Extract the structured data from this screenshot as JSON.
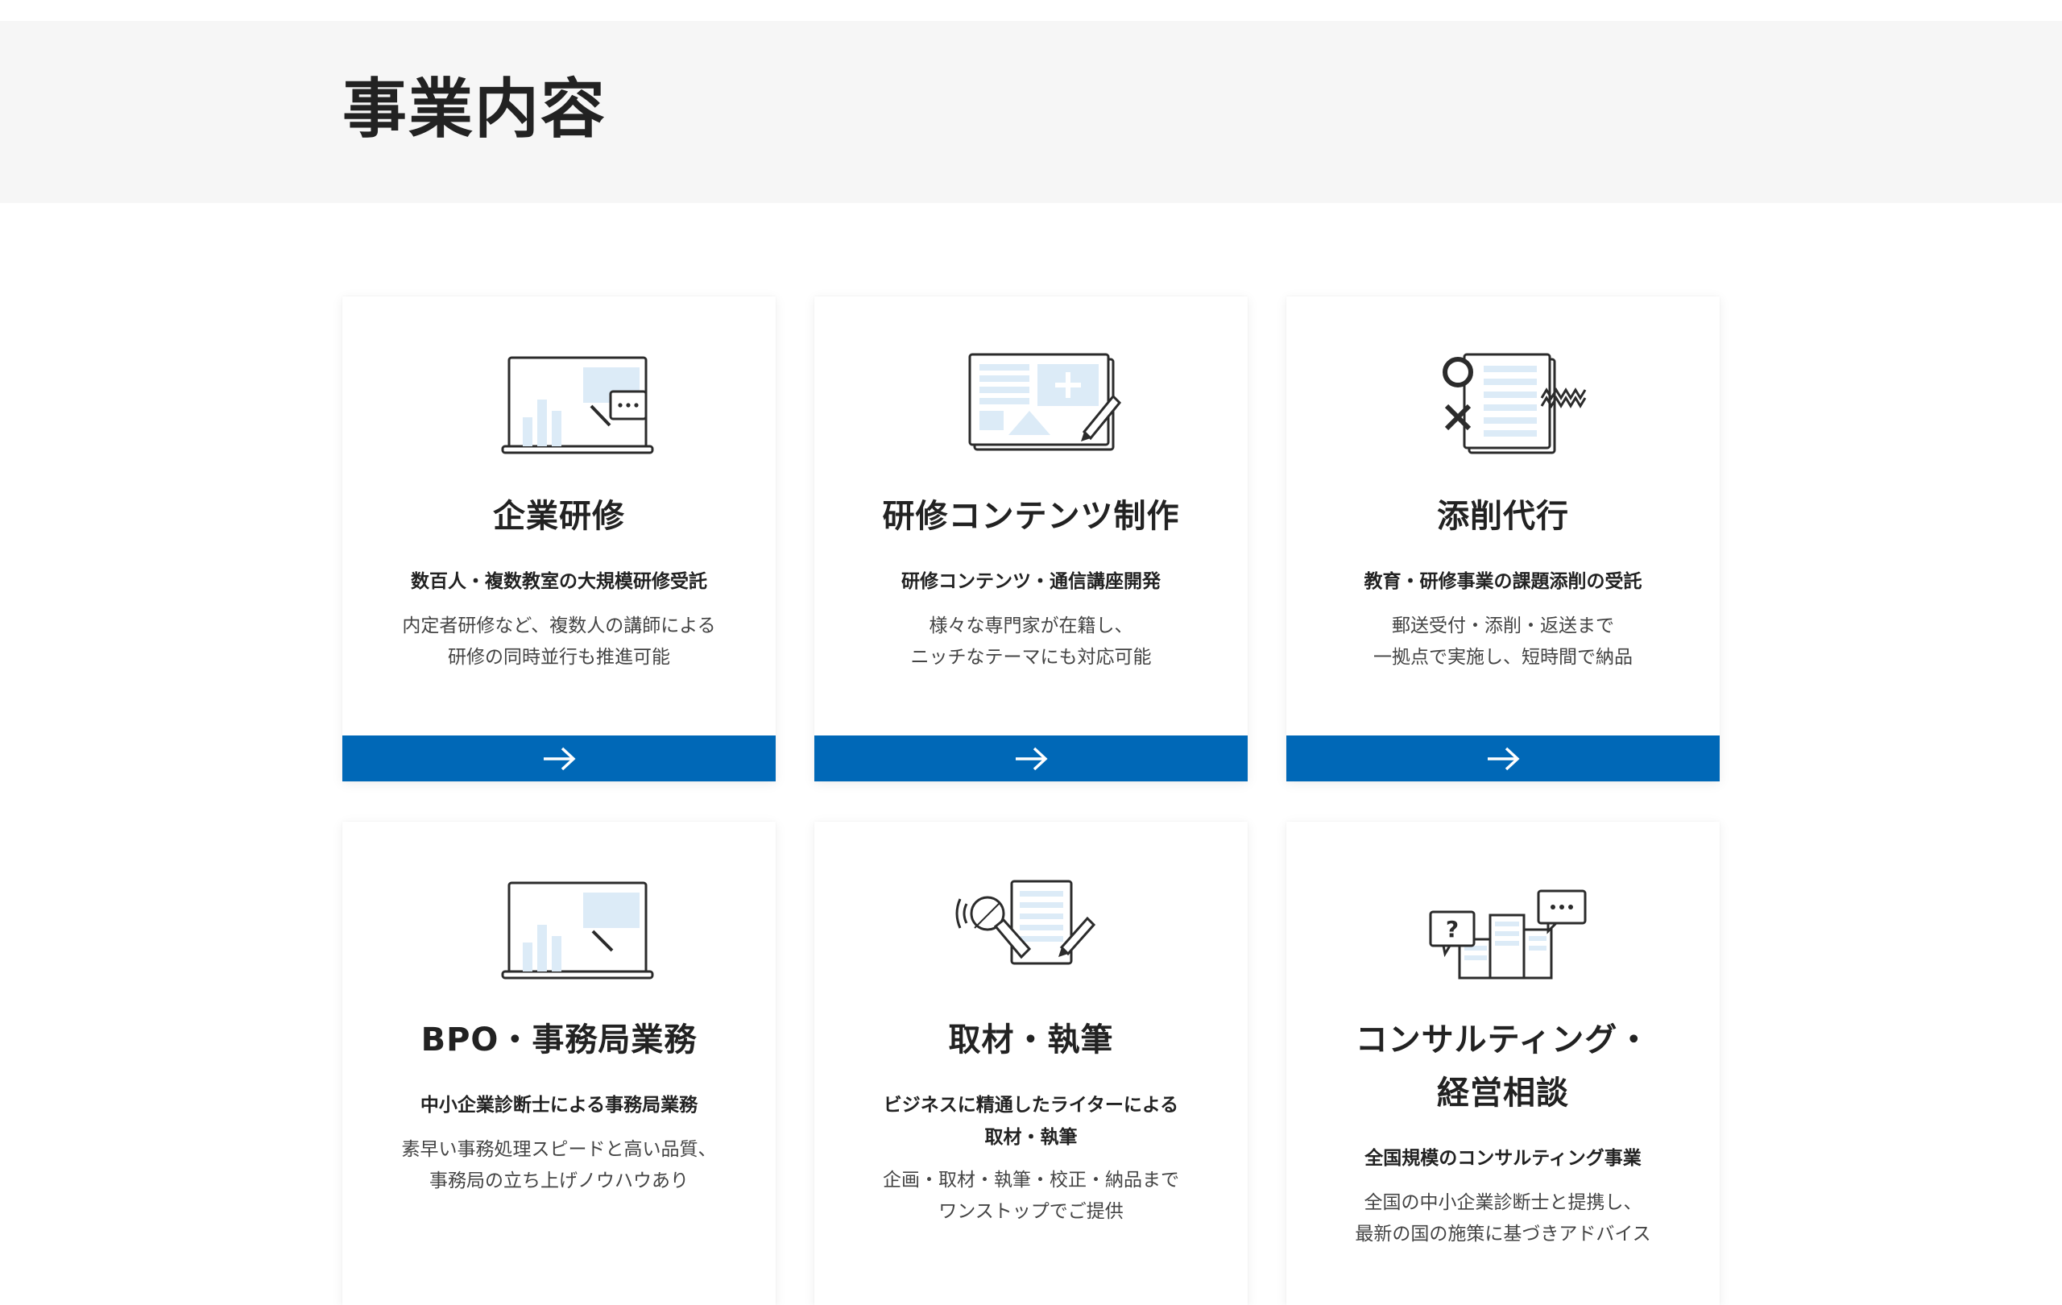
{
  "page": {
    "title": "事業内容"
  },
  "colors": {
    "header_bg": "#f6f6f6",
    "accent": "#0068b7",
    "icon_fill": "#dcebf7",
    "icon_stroke": "#2b2b2b"
  },
  "cards": [
    {
      "title": [
        "企業研修"
      ],
      "subtitle": [
        "数百人・複数教室の大規模研修受託"
      ],
      "description": [
        "内定者研修など、複数人の講師による",
        "研修の同時並行も推進可能"
      ],
      "icon": "laptop-chat-icon",
      "cta_icon": "arrow-right-icon"
    },
    {
      "title": [
        "研修コンテンツ制作"
      ],
      "subtitle": [
        "研修コンテンツ・通信講座開発"
      ],
      "description": [
        "様々な専門家が在籍し、",
        "ニッチなテーマにも対応可能"
      ],
      "icon": "document-pen-icon",
      "cta_icon": "arrow-right-icon"
    },
    {
      "title": [
        "添削代行"
      ],
      "subtitle": [
        "教育・研修事業の課題添削の受託"
      ],
      "description": [
        "郵送受付・添削・返送まで",
        "一拠点で実施し、短時間で納品"
      ],
      "icon": "grading-icon",
      "cta_icon": "arrow-right-icon"
    },
    {
      "title": [
        "BPO・事務局業務"
      ],
      "subtitle": [
        "中小企業診断士による事務局業務"
      ],
      "description": [
        "素早い事務処理スピードと高い品質、",
        "事務局の立ち上げノウハウあり"
      ],
      "icon": "laptop-icon",
      "cta_icon": "arrow-right-icon"
    },
    {
      "title": [
        "取材・執筆"
      ],
      "subtitle": [
        "ビジネスに精通したライターによる",
        "取材・執筆"
      ],
      "description": [
        "企画・取材・執筆・校正・納品まで",
        "ワンストップでご提供"
      ],
      "icon": "microphone-document-icon",
      "cta_icon": "arrow-right-icon"
    },
    {
      "title": [
        "コンサルティング・",
        "経営相談"
      ],
      "subtitle": [
        "全国規模のコンサルティング事業"
      ],
      "description": [
        "全国の中小企業診断士と提携し、",
        "最新の国の施策に基づきアドバイス"
      ],
      "icon": "buildings-consult-icon",
      "cta_icon": "arrow-right-icon"
    }
  ]
}
